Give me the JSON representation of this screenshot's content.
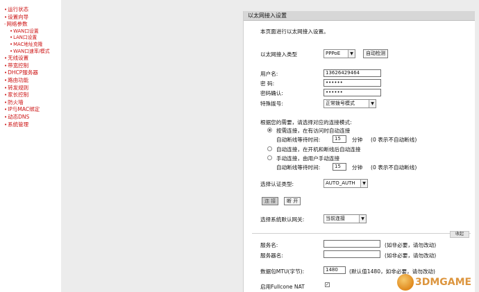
{
  "sidebar": {
    "items": [
      {
        "label": "运行状态",
        "child": false
      },
      {
        "label": "设置向导",
        "child": false
      },
      {
        "label": "网络参数",
        "child": false,
        "prefix": "-"
      },
      {
        "label": "WAN口设置",
        "child": true
      },
      {
        "label": "LAN口设置",
        "child": true
      },
      {
        "label": "MAC地址克隆",
        "child": true
      },
      {
        "label": "WAN口速率/模式",
        "child": true
      },
      {
        "label": "无线设置",
        "child": false
      },
      {
        "label": "带宽控制",
        "child": false
      },
      {
        "label": "DHCP服务器",
        "child": false
      },
      {
        "label": "路由功能",
        "child": false
      },
      {
        "label": "转发规则",
        "child": false
      },
      {
        "label": "家长控制",
        "child": false
      },
      {
        "label": "防火墙",
        "child": false
      },
      {
        "label": "IP与MAC绑定",
        "child": false
      },
      {
        "label": "动态DNS",
        "child": false
      },
      {
        "label": "系统管理",
        "child": false
      }
    ]
  },
  "panel": {
    "title": "以太网接入设置",
    "intro": "本页面进行以太网接入设置。",
    "wan_type_label": "以太网接入类型",
    "wan_type_value": "PPPoE",
    "auto_detect_label": "自动检测",
    "username_label": "用户名:",
    "username_value": "13626429464",
    "password_label": "密  码:",
    "password_value": "••••••",
    "confirm_label": "密码确认:",
    "confirm_value": "••••••",
    "dial_label": "特殊拨号:",
    "dial_value": "正常拨号模式",
    "mode_heading": "根据您的需要，请选择对应的连接模式:",
    "mode_demand": "按需连接，在有访问时自动连接",
    "idle_label": "自动断线等待时间:",
    "idle_value_1": "15",
    "idle_unit": "分钟",
    "idle_hint": "(0 表示不自动断线)",
    "mode_auto": "自动连接，在开机和断线后自动连接",
    "mode_manual": "手动连接，由用户手动连接",
    "idle_value_2": "15",
    "auth_label": "选择认证类型:",
    "auth_value": "AUTO_AUTH",
    "connect_label": "连 接",
    "disconnect_label": "断 开",
    "gateway_label": "选择系统默认网关:",
    "gateway_value": "当前连接",
    "advanced_label": "收起",
    "service_label": "服务名:",
    "service_hint": "(如非必要，请勿改动)",
    "server_label": "服务器名:",
    "server_hint": "(如非必要，请勿改动)",
    "mtu_label": "数据包MTU(字节):",
    "mtu_value": "1480",
    "mtu_hint": "(默认值1480，如非必要，请勿改动)",
    "fullcone_label": "启用Fullcone NAT",
    "fullcone_mark": "✓"
  },
  "watermark": {
    "text": "3DMGAME"
  }
}
